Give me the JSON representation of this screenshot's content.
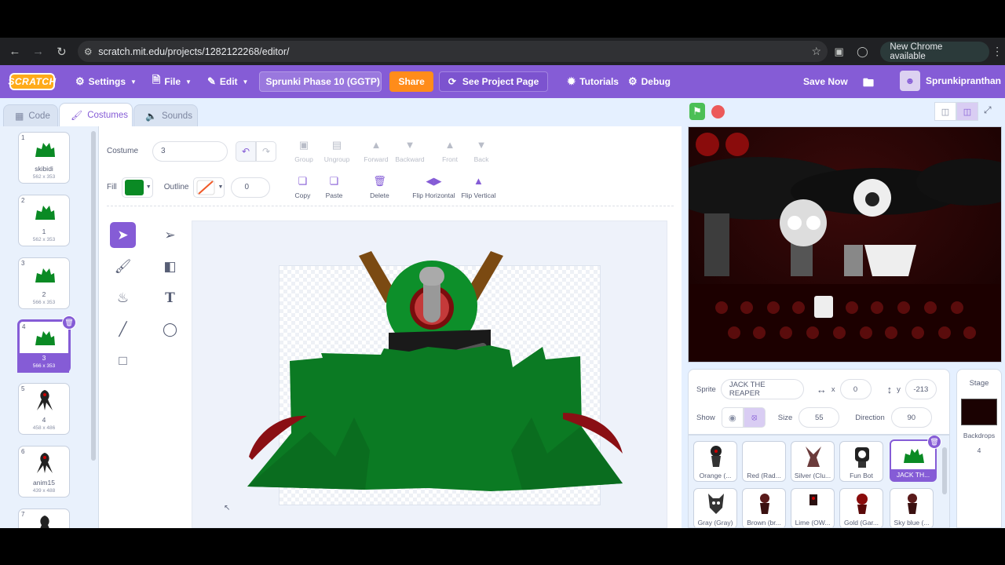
{
  "browser": {
    "url": "scratch.mit.edu/projects/1282122268/editor/",
    "update_label": "New Chrome available"
  },
  "menubar": {
    "logo": "SCRATCH",
    "settings": "Settings",
    "file": "File",
    "edit": "Edit",
    "project_title": "Sprunki Phase 10 (GGTP) ...",
    "share": "Share",
    "see_project": "See Project Page",
    "tutorials": "Tutorials",
    "debug": "Debug",
    "save_now": "Save Now",
    "username": "Sprunkipranthan"
  },
  "tabs": {
    "code": "Code",
    "costumes": "Costumes",
    "sounds": "Sounds"
  },
  "costumes": [
    {
      "num": "1",
      "name": "skibidi",
      "size": "562 x 353"
    },
    {
      "num": "2",
      "name": "1",
      "size": "562 x 353"
    },
    {
      "num": "3",
      "name": "2",
      "size": "566 x 353"
    },
    {
      "num": "4",
      "name": "3",
      "size": "566 x 353",
      "selected": true
    },
    {
      "num": "5",
      "name": "4",
      "size": "458 x 486"
    },
    {
      "num": "6",
      "name": "anim15",
      "size": "439 x 488"
    },
    {
      "num": "7",
      "name": "",
      "size": ""
    }
  ],
  "editor": {
    "costume_label": "Costume",
    "costume_name": "3",
    "group": "Group",
    "ungroup": "Ungroup",
    "forward": "Forward",
    "backward": "Backward",
    "front": "Front",
    "back": "Back",
    "fill_label": "Fill",
    "outline_label": "Outline",
    "outline_width": "0",
    "copy": "Copy",
    "paste": "Paste",
    "delete": "Delete",
    "flip_h": "Flip Horizontal",
    "flip_v": "Flip Vertical",
    "fill_color": "#0a8a24"
  },
  "sprite": {
    "label": "Sprite",
    "name": "JACK THE REAPER",
    "x_label": "x",
    "x": "0",
    "y_label": "y",
    "y": "-213",
    "show_label": "Show",
    "size_label": "Size",
    "size": "55",
    "direction_label": "Direction",
    "direction": "90"
  },
  "sprites": [
    {
      "name": "Orange (..."
    },
    {
      "name": "Red (Rad..."
    },
    {
      "name": "Silver (Clu..."
    },
    {
      "name": "Fun Bot"
    },
    {
      "name": "JACK TH...",
      "selected": true
    },
    {
      "name": "Gray (Gray)"
    },
    {
      "name": "Brown (br..."
    },
    {
      "name": "Lime (OW..."
    },
    {
      "name": "Gold (Gar..."
    },
    {
      "name": "Sky blue (..."
    }
  ],
  "stage_pane": {
    "title": "Stage",
    "backdrops_label": "Backdrops",
    "backdrops_count": "4"
  }
}
